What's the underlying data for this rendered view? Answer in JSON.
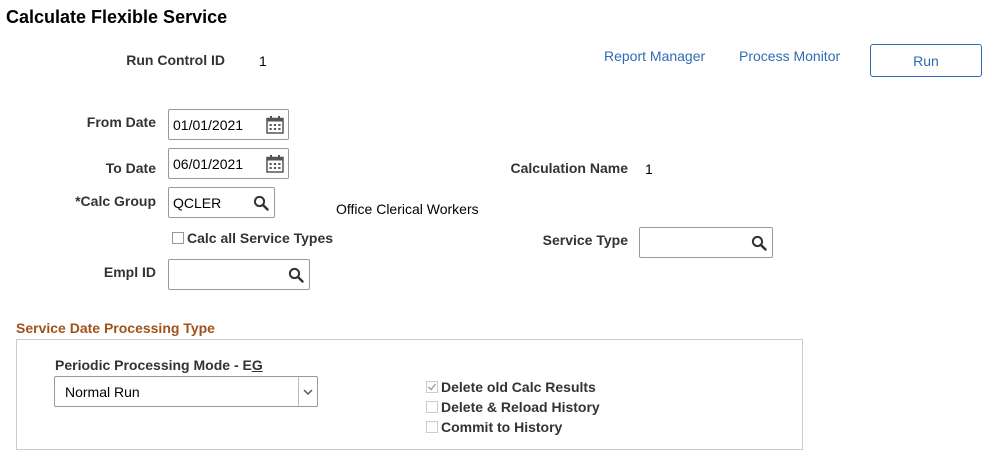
{
  "page": {
    "title": "Calculate Flexible Service"
  },
  "header": {
    "run_control_label": "Run Control ID",
    "run_control_value": "1",
    "report_manager_link": "Report Manager",
    "process_monitor_link": "Process Monitor",
    "run_button": "Run"
  },
  "form": {
    "from_date_label": "From Date",
    "from_date_value": "01/01/2021",
    "to_date_label": "To Date",
    "to_date_value": "06/01/2021",
    "calc_name_label": "Calculation Name",
    "calc_name_value": "1",
    "calc_group_label": "*Calc Group",
    "calc_group_value": "QCLER",
    "calc_group_desc": "Office Clerical Workers",
    "calc_all_label": "Calc all Service Types",
    "calc_all_checked": false,
    "service_type_label": "Service Type",
    "service_type_value": "",
    "empl_id_label": "Empl ID",
    "empl_id_value": ""
  },
  "processing": {
    "section_title": "Service Date Processing Type",
    "mode_label_prefix": "Periodic Processing Mode - E",
    "mode_label_ul": "G",
    "mode_value": "Normal Run",
    "delete_old_label": "Delete old Calc Results",
    "delete_old_checked": true,
    "delete_reload_label": "Delete & Reload History",
    "delete_reload_checked": false,
    "commit_label": "Commit to History",
    "commit_checked": false
  },
  "colors": {
    "link": "#2f6cb3",
    "section_title": "#a0521c"
  }
}
